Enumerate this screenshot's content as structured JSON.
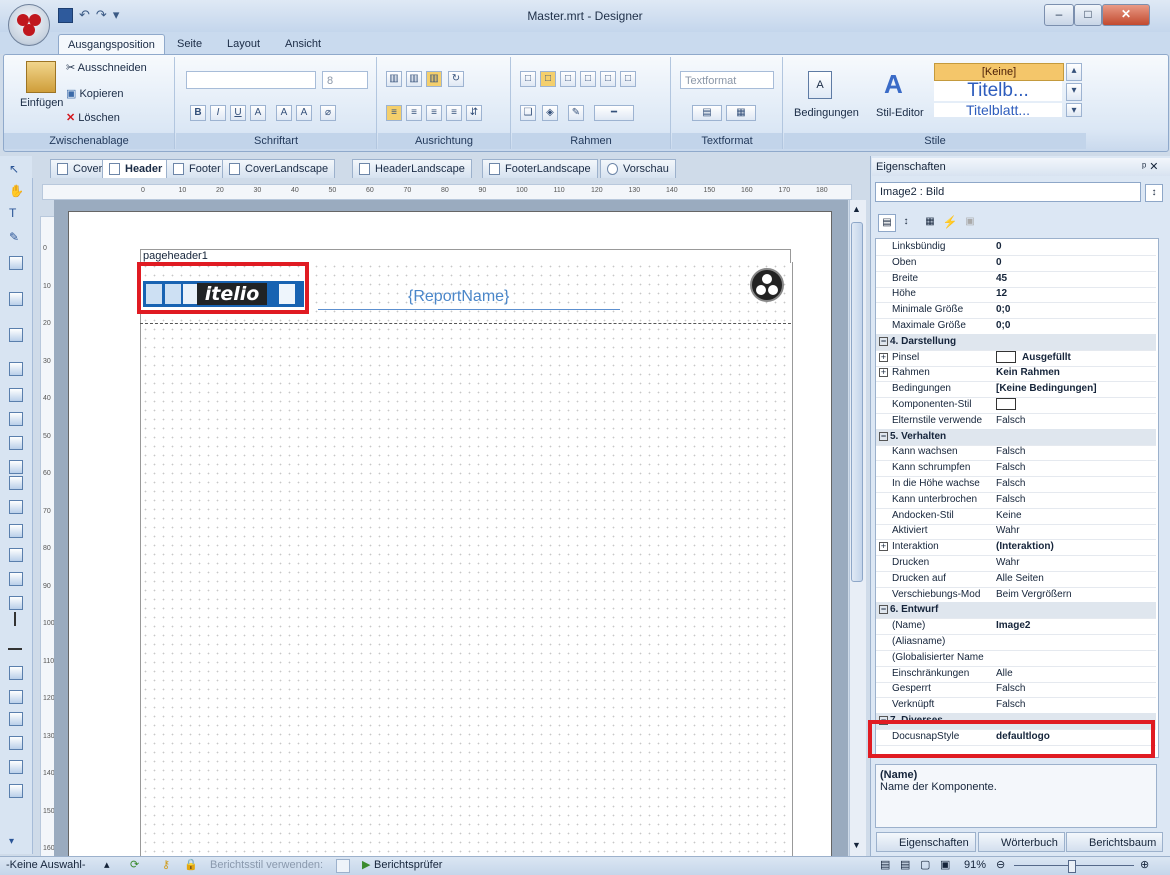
{
  "window": {
    "title": "Master.mrt - Designer"
  },
  "ribbon_tabs": [
    "Ausgangsposition",
    "Seite",
    "Layout",
    "Ansicht"
  ],
  "clipboard": {
    "paste": "Einfügen",
    "cut": "Ausschneiden",
    "copy": "Kopieren",
    "delete": "Löschen",
    "caption": "Zwischenablage"
  },
  "font": {
    "size": "8",
    "caption": "Schriftart"
  },
  "alignment": {
    "caption": "Ausrichtung"
  },
  "borders": {
    "caption": "Rahmen"
  },
  "textformat": {
    "combo": "Textformat",
    "caption": "Textformat"
  },
  "conditions": {
    "label": "Bedingungen"
  },
  "style_editor": {
    "label": "Stil-Editor"
  },
  "styles": {
    "none": "[Keine]",
    "sample1": "Titelb...",
    "sample2": "Titelblatt...",
    "caption": "Stile"
  },
  "doc_tabs": [
    "Cover",
    "Header",
    "Footer",
    "CoverLandscape",
    "HeaderLandscape",
    "FooterLandscape",
    "Vorschau"
  ],
  "ruler_h": [
    "0",
    "10",
    "20",
    "30",
    "40",
    "50",
    "60",
    "70",
    "80",
    "90",
    "100",
    "110",
    "120",
    "130",
    "140",
    "150",
    "160",
    "170",
    "180"
  ],
  "ruler_v": [
    "0",
    "10",
    "20",
    "30",
    "40",
    "50",
    "60",
    "70",
    "80",
    "90",
    "100",
    "110",
    "120",
    "130",
    "140",
    "150",
    "160"
  ],
  "designer": {
    "band": "pageheader1",
    "logo_text": "itelio",
    "report_name": "{ReportName}"
  },
  "props": {
    "panel_title": "Eigenschaften",
    "object": "Image2 : Bild",
    "rows": [
      {
        "k": "Linksbündig",
        "v": "0",
        "b": true
      },
      {
        "k": "Oben",
        "v": "0",
        "b": true
      },
      {
        "k": "Breite",
        "v": "45",
        "b": true
      },
      {
        "k": "Höhe",
        "v": "12",
        "b": true
      },
      {
        "k": "Minimale Größe",
        "v": "0;0",
        "b": true
      },
      {
        "k": "Maximale Größe",
        "v": "0;0",
        "b": true
      },
      {
        "k": "4. Darstellung",
        "cat": true
      },
      {
        "k": "Pinsel",
        "v": "Ausgefüllt",
        "b": true,
        "exp": true,
        "swatch": true
      },
      {
        "k": "Rahmen",
        "v": "Kein Rahmen",
        "b": true,
        "exp": true
      },
      {
        "k": "Bedingungen",
        "v": "[Keine Bedingungen]",
        "b": true
      },
      {
        "k": "Komponenten-Stil",
        "v": "",
        "swatch": true
      },
      {
        "k": "Elternstile verwende",
        "v": "Falsch"
      },
      {
        "k": "5. Verhalten",
        "cat": true
      },
      {
        "k": "Kann wachsen",
        "v": "Falsch"
      },
      {
        "k": "Kann schrumpfen",
        "v": "Falsch"
      },
      {
        "k": "In die Höhe wachse",
        "v": "Falsch"
      },
      {
        "k": "Kann unterbrochen",
        "v": "Falsch"
      },
      {
        "k": "Andocken-Stil",
        "v": "Keine"
      },
      {
        "k": "Aktiviert",
        "v": "Wahr"
      },
      {
        "k": "Interaktion",
        "v": "(Interaktion)",
        "b": true,
        "exp": true
      },
      {
        "k": "Drucken",
        "v": "Wahr"
      },
      {
        "k": "Drucken auf",
        "v": "Alle Seiten"
      },
      {
        "k": "Verschiebungs-Mod",
        "v": "Beim Vergrößern"
      },
      {
        "k": "6. Entwurf",
        "cat": true
      },
      {
        "k": "(Name)",
        "v": "Image2",
        "b": true
      },
      {
        "k": "(Aliasname)",
        "v": ""
      },
      {
        "k": "(Globalisierter Name",
        "v": ""
      },
      {
        "k": "Einschränkungen",
        "v": "Alle"
      },
      {
        "k": "Gesperrt",
        "v": "Falsch"
      },
      {
        "k": "Verknüpft",
        "v": "Falsch"
      },
      {
        "k": "7. Diverses",
        "cat": true
      },
      {
        "k": "DocusnapStyle",
        "v": "defaultlogo",
        "b": true
      }
    ],
    "desc_title": "(Name)",
    "desc_text": "Name der Komponente.",
    "bottom_tabs": [
      "Eigenschaften",
      "Wörterbuch",
      "Berichtsbaum"
    ]
  },
  "status": {
    "selection": "-Keine Auswahl-",
    "report_style": "Berichtsstil verwenden:",
    "checker": "Berichtsprüfer",
    "zoom": "91%"
  },
  "colors": {
    "highlight": "#e01b22",
    "ribbon": "#dbe7f5",
    "logo_blue": "#1863b2"
  }
}
